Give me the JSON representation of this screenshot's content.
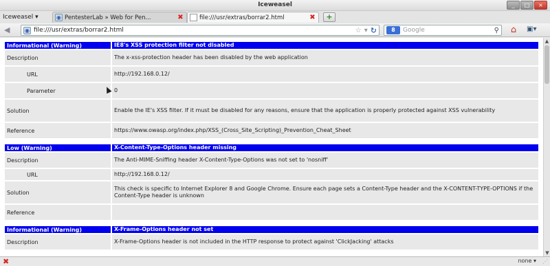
{
  "window": {
    "title": "Iceweasel"
  },
  "app_menu": {
    "label": "Iceweasel"
  },
  "tabs": [
    {
      "label": "PentesterLab » Web for Pen..."
    },
    {
      "label": "file:///usr/extras/borrar2.html"
    }
  ],
  "nav": {
    "url": "file:///usr/extras/borrar2.html",
    "search_engine": "8",
    "search_placeholder": "Google"
  },
  "report": [
    {
      "header": {
        "severity": "Informational (Warning)",
        "title": "IE8's XSS protection filter not disabled"
      },
      "rows": [
        {
          "label": "Description",
          "value": "The x-xss-protection header has been disabled by the web application"
        },
        {
          "label": "URL",
          "value": "http://192.168.0.12/",
          "indent": true
        },
        {
          "label": "Parameter",
          "value": "0",
          "indent": true
        },
        {
          "label": "Solution",
          "value": "Enable the IE's XSS filter. If it must be disabled for any reasons, ensure that the application is properly protected against XSS vulnerability"
        },
        {
          "label": "Reference",
          "value": "https://www.owasp.org/index.php/XSS_(Cross_Site_Scripting)_Prevention_Cheat_Sheet"
        }
      ]
    },
    {
      "header": {
        "severity": "Low (Warning)",
        "title": "X-Content-Type-Options header missing"
      },
      "rows": [
        {
          "label": "Description",
          "value": "The Anti-MIME-Sniffing header X-Content-Type-Options was not set to 'nosniff'"
        },
        {
          "label": "URL",
          "value": "http://192.168.0.12/",
          "indent": true
        },
        {
          "label": "Solution",
          "value": "This check is specific to Internet Explorer 8 and Google Chrome. Ensure each page sets a Content-Type header and the X-CONTENT-TYPE-OPTIONS if the Content-Type header is unknown"
        },
        {
          "label": "Reference",
          "value": ""
        }
      ]
    },
    {
      "header": {
        "severity": "Informational (Warning)",
        "title": "X-Frame-Options header not set"
      },
      "rows": [
        {
          "label": "Description",
          "value": "X-Frame-Options header is not included in the HTTP response to protect against 'ClickJacking' attacks"
        }
      ]
    }
  ],
  "status": {
    "zoom": "none"
  },
  "colors": {
    "header_bg": "#0000ee",
    "cell_bg": "#e8e8e8"
  }
}
